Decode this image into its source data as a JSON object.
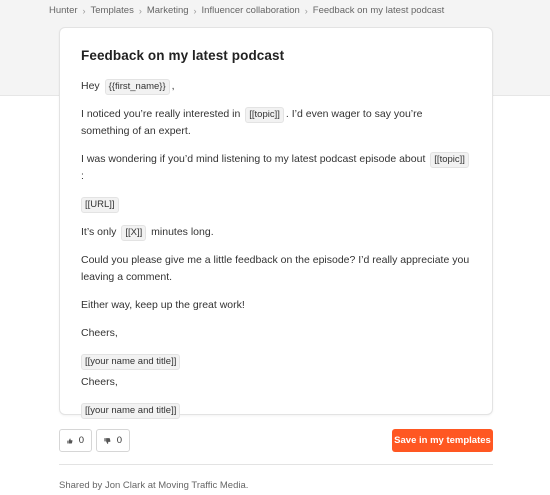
{
  "breadcrumb": [
    "Hunter",
    "Templates",
    "Marketing",
    "Influencer collaboration",
    "Feedback on my latest podcast"
  ],
  "template": {
    "title": "Feedback on my latest podcast",
    "greeting_pre": "Hey",
    "greeting_var": "{{first_name}}",
    "greeting_post": ",",
    "p1_pre": "I noticed you’re really interested in",
    "p1_var": "[[topic]]",
    "p1_post": ". I’d even wager to say you’re something of an expert.",
    "p2_pre": "I was wondering if you’d mind listening to my latest podcast episode about",
    "p2_var": "[[topic]]",
    "p2_post": ":",
    "url_var": "[[URL]]",
    "p3_pre": "It’s only",
    "p3_var": "[[X]]",
    "p3_post": "minutes long.",
    "p4": "Could you please give me a little feedback on the episode? I’d really appreciate you leaving a comment.",
    "p5": "Either way, keep up the great work!",
    "signoff1": "Cheers,",
    "signature1": "[[your name and title]]",
    "signoff2": "Cheers,",
    "signature2": "[[your name and title]]"
  },
  "actions": {
    "upvotes": "0",
    "downvotes": "0",
    "save_label": "Save in my templates"
  },
  "footer": {
    "shared_by": "Shared by Jon Clark at Moving Traffic Media."
  },
  "colors": {
    "accent": "#ff5722",
    "top_band": "#f4f4f4"
  }
}
